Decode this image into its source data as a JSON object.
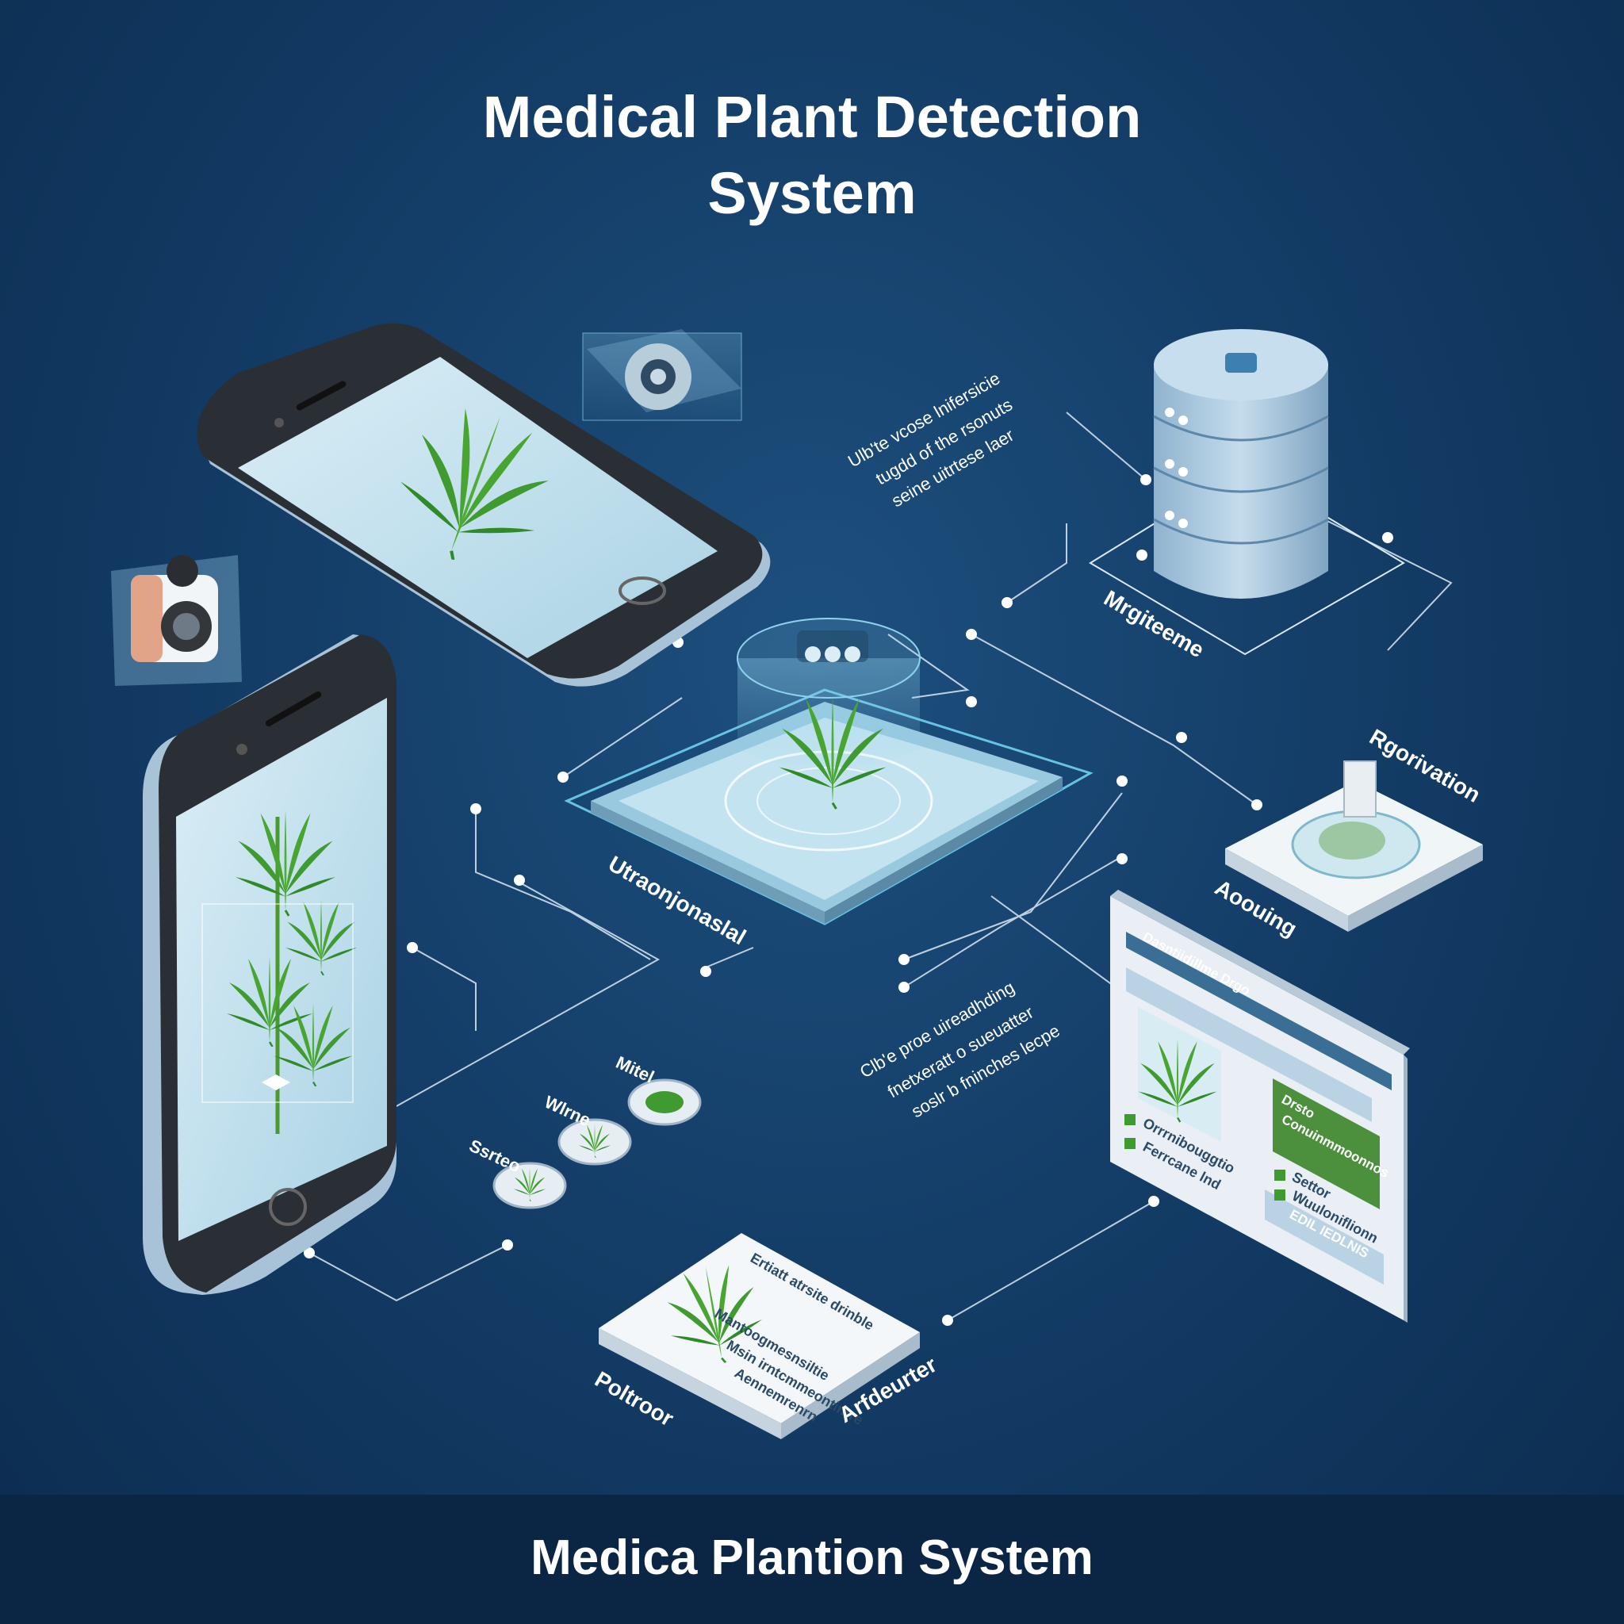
{
  "title": {
    "line1": "Medical Plant Detection",
    "line2": "System"
  },
  "footer": "Medica Plantion System",
  "labels": {
    "mobile_phone_center": "Utraonjonaslal",
    "database": "Mrgiteeme",
    "recognition": "Rgorivation",
    "accounting": "Aoouing",
    "results_left": "Poltroor",
    "results_right": "Arfdeurter",
    "icon_a": "Ssrteo",
    "icon_b": "Wlrne",
    "icon_c": "Mitel"
  },
  "descriptions": {
    "top": [
      "Ulb'te vcose lnifersicie",
      "tugdd of the rsonuts",
      "seine uitrtese laer"
    ],
    "middle": [
      "Clb'e proe uireadhding",
      "fnetxeratt o sueuatter",
      "soslr b fninches lecpe"
    ]
  },
  "dashboard": {
    "header": "Dasntiidillme Drgo",
    "side_items": [
      "Orrrnibouggtio",
      "Ferrcane   lnd"
    ],
    "green_card": [
      "Drsto",
      "Conuinmmoonnos"
    ],
    "list_items": [
      "Settor",
      "Wuuloniflionn"
    ],
    "button": "EDIL IEDLNIS"
  },
  "result_card": {
    "heading": "Ertiatt atrsite drinble",
    "lines": [
      "Mantoogmesnsiltie",
      "Msin irntcmmeontinrre",
      "Aennemrenrn"
    ]
  },
  "colors": {
    "background": "#123a63",
    "leaf_green": "#3f9a2f",
    "accent_cyan": "#8fd3ee",
    "device_body": "#b8d2e6",
    "panel_green": "#4c8f3c"
  }
}
